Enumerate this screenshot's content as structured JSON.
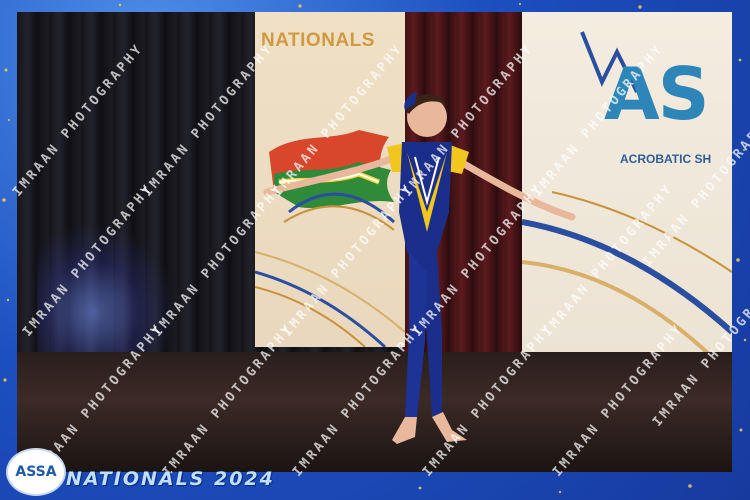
{
  "photo": {
    "banner_left_title": "NATIONALS",
    "banner_right_logo": "AS",
    "banner_right_subtitle": "ACROBATIC SH"
  },
  "watermark": {
    "text": "IMRAAN PHOTOGRAPHY"
  },
  "footer": {
    "logo_text": "ASSA",
    "event_title": "NATIONALS 2024"
  },
  "colors": {
    "frame_blue": "#1c4fc0",
    "costume_blue": "#1b2f8a",
    "costume_yellow": "#f1c61e",
    "banner_gold": "#d19a40",
    "logo_blue": "#2e86b8"
  }
}
